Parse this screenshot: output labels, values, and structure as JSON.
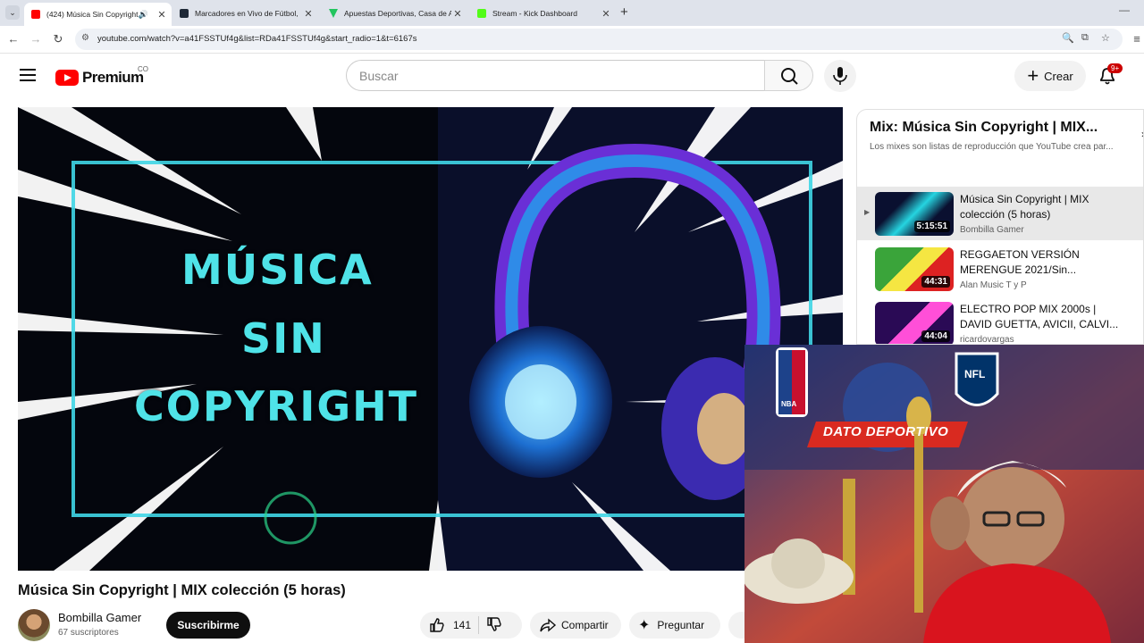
{
  "browser": {
    "tabs": [
      {
        "title": "(424) Música Sin Copyright",
        "active": true,
        "favicon_color": "#ff0000"
      },
      {
        "title": "Marcadores en Vivo de Fútbol,",
        "active": false,
        "favicon_color": "#1f2937"
      },
      {
        "title": "Apuestas Deportivas, Casa de A",
        "active": false,
        "favicon_color": "#22c55e"
      },
      {
        "title": "Stream - Kick Dashboard",
        "active": false,
        "favicon_color": "#53fc18"
      }
    ],
    "url": "youtube.com/watch?v=a41FSSTUf4g&list=RDa41FSSTUf4g&start_radio=1&t=6167s"
  },
  "header": {
    "logo_text": "Premium",
    "country_code": "CO",
    "search_placeholder": "Buscar",
    "create_label": "Crear",
    "notification_count": "9+"
  },
  "player": {
    "art_lines": [
      "MÚSICA",
      "SIN",
      "COPYRIGHT"
    ]
  },
  "video": {
    "title": "Música Sin Copyright | MIX colección (5 horas)",
    "channel": "Bombilla Gamer",
    "subscribers": "67 suscriptores",
    "subscribe_label": "Suscribirme",
    "likes": "141",
    "share_label": "Compartir",
    "ask_label": "Preguntar"
  },
  "playlist": {
    "title": "Mix: Música Sin Copyright | MIX...",
    "subtitle": "Los mixes son listas de reproducción que YouTube crea par...",
    "items": [
      {
        "title": "Música Sin Copyright | MIX colección (5 horas)",
        "channel": "Bombilla Gamer",
        "duration": "5:15:51",
        "indicator": "▶",
        "thumb_colors": [
          "#0a1030",
          "#25d4e0"
        ]
      },
      {
        "title": "REGGAETON VERSIÓN MERENGUE 2021/Sin...",
        "channel": "Alan Music T y P",
        "duration": "44:31",
        "indicator": "",
        "thumb_colors": [
          "#3aa43a",
          "#f5e642"
        ]
      },
      {
        "title": "ELECTRO POP MIX 2000s | DAVID GUETTA, AVICII, CALVI...",
        "channel": "ricardovargas",
        "duration": "44:04",
        "indicator": "",
        "thumb_colors": [
          "#2a0a55",
          "#ff4fd8"
        ]
      }
    ]
  },
  "webcam": {
    "banner_text": "DATO DEPORTIVO",
    "logos": [
      "NBA",
      "NFL"
    ]
  },
  "colors": {
    "youtube_red": "#ff0000",
    "art_cyan": "#4fe3e8",
    "subscribe_bg": "#0f0f0f"
  }
}
